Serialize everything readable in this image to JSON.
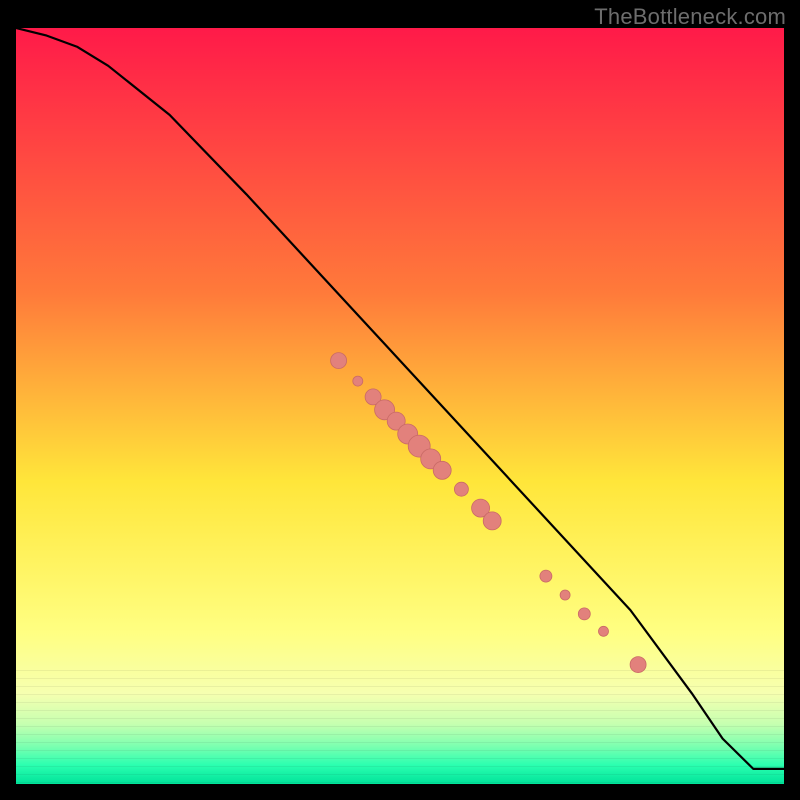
{
  "watermark": "TheBottleneck.com",
  "colors": {
    "curve": "#000000",
    "marker_fill": "#e2817c",
    "marker_stroke": "#c96a66",
    "background": "#000000"
  },
  "chart_data": {
    "type": "line",
    "title": "",
    "xlabel": "",
    "ylabel": "",
    "xlim": [
      0,
      100
    ],
    "ylim": [
      0,
      100
    ],
    "grid": false,
    "legend": false,
    "annotations": [],
    "gradient_stops": [
      {
        "y_pct": 0.0,
        "color": "#ff1a49"
      },
      {
        "y_pct": 35.0,
        "color": "#ff7a3a"
      },
      {
        "y_pct": 60.0,
        "color": "#ffe63a"
      },
      {
        "y_pct": 80.0,
        "color": "#ffff82"
      },
      {
        "y_pct": 88.0,
        "color": "#f6ffb0"
      },
      {
        "y_pct": 92.0,
        "color": "#c7ffb0"
      },
      {
        "y_pct": 95.0,
        "color": "#7cffb0"
      },
      {
        "y_pct": 97.5,
        "color": "#2bffb0"
      },
      {
        "y_pct": 100.0,
        "color": "#00e39a"
      }
    ],
    "series": [
      {
        "name": "bottleneck-curve",
        "x": [
          0,
          4,
          8,
          12,
          20,
          30,
          40,
          50,
          60,
          70,
          80,
          88,
          92,
          96,
          100
        ],
        "y": [
          100,
          99,
          97.5,
          95,
          88.5,
          78,
          67,
          56,
          45,
          34,
          23,
          12,
          6,
          2,
          2
        ]
      }
    ],
    "markers": [
      {
        "x": 42.0,
        "y": 56.0,
        "r": 8
      },
      {
        "x": 44.5,
        "y": 53.3,
        "r": 5
      },
      {
        "x": 46.5,
        "y": 51.2,
        "r": 8
      },
      {
        "x": 48.0,
        "y": 49.5,
        "r": 10
      },
      {
        "x": 49.5,
        "y": 48.0,
        "r": 9
      },
      {
        "x": 51.0,
        "y": 46.3,
        "r": 10
      },
      {
        "x": 52.5,
        "y": 44.7,
        "r": 11
      },
      {
        "x": 54.0,
        "y": 43.0,
        "r": 10
      },
      {
        "x": 55.5,
        "y": 41.5,
        "r": 9
      },
      {
        "x": 58.0,
        "y": 39.0,
        "r": 7
      },
      {
        "x": 60.5,
        "y": 36.5,
        "r": 9
      },
      {
        "x": 62.0,
        "y": 34.8,
        "r": 9
      },
      {
        "x": 69.0,
        "y": 27.5,
        "r": 6
      },
      {
        "x": 71.5,
        "y": 25.0,
        "r": 5
      },
      {
        "x": 74.0,
        "y": 22.5,
        "r": 6
      },
      {
        "x": 76.5,
        "y": 20.2,
        "r": 5
      },
      {
        "x": 81.0,
        "y": 15.8,
        "r": 8
      }
    ]
  }
}
